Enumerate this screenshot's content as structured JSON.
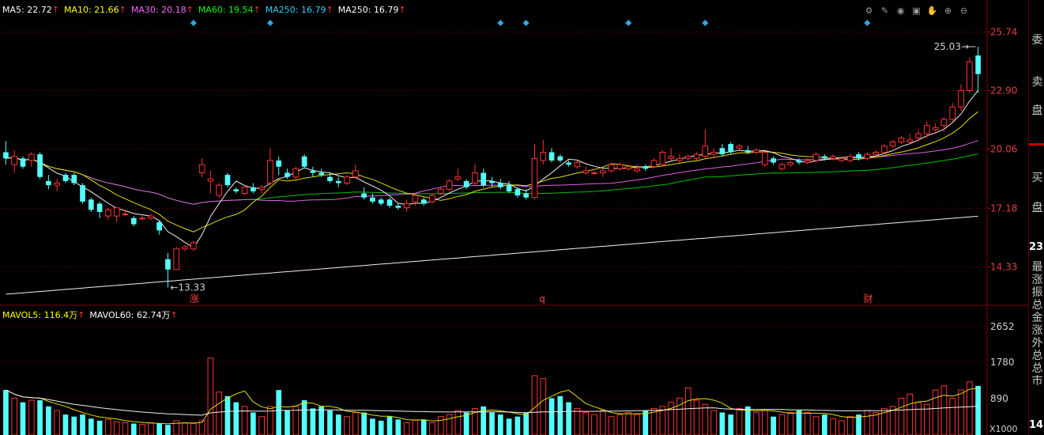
{
  "ma_legend": [
    {
      "label": "MA5: 22.72",
      "color": "#ffffff"
    },
    {
      "label": "MA10: 21.66",
      "color": "#ffff00"
    },
    {
      "label": "MA30: 20.18",
      "color": "#ff66ff"
    },
    {
      "label": "MA60: 19.54",
      "color": "#00ff00"
    },
    {
      "label": "MA250: 16.79",
      "color": "#33ccff"
    },
    {
      "label": "MA250: 16.79",
      "color": "#ffffff"
    }
  ],
  "arrow": "↑",
  "arrow_color": "#ff3333",
  "vol_legend": [
    {
      "label": "MAVOL5: 116.4万",
      "color": "#ffff00"
    },
    {
      "label": "MAVOL60: 62.74万",
      "color": "#ffffff"
    }
  ],
  "toolbar_icons": [
    "settings-icon",
    "pen-icon",
    "eye-icon",
    "save-icon",
    "hand-icon",
    "zoom-in-icon",
    "zoom-out-icon"
  ],
  "sidepanel": {
    "top_label": "委",
    "sell": [
      "卖",
      "盘"
    ],
    "buy": [
      "买",
      "盘"
    ],
    "number": "23",
    "stack": [
      "最",
      "涨",
      "振",
      "总",
      "金",
      "涨",
      "外",
      "总",
      "总",
      "市"
    ],
    "bottom_number": "14"
  },
  "chart_data": [
    {
      "type": "candlestick",
      "y_ticks": [
        25.74,
        22.9,
        20.06,
        17.18,
        14.33
      ],
      "ylim": [
        12.5,
        26.3
      ],
      "max_label": "25.03",
      "min_label": "13.33",
      "markers": [
        {
          "text": "涨",
          "index": 22
        },
        {
          "text": "q",
          "index": 63
        },
        {
          "text": "财",
          "index": 101
        }
      ],
      "diamond_indices": [
        22,
        31,
        58,
        61,
        73,
        82,
        101
      ],
      "ohlc": [
        [
          19.9,
          20.45,
          19.3,
          19.6
        ],
        [
          19.3,
          20.0,
          18.9,
          19.7
        ],
        [
          19.6,
          19.7,
          19.1,
          19.2
        ],
        [
          19.5,
          19.9,
          19.2,
          19.8
        ],
        [
          19.8,
          19.9,
          18.6,
          18.7
        ],
        [
          18.5,
          18.8,
          18.1,
          18.3
        ],
        [
          18.3,
          18.6,
          18.0,
          18.4
        ],
        [
          18.8,
          18.9,
          18.4,
          18.5
        ],
        [
          18.8,
          18.9,
          18.3,
          18.4
        ],
        [
          18.3,
          18.4,
          17.4,
          17.5
        ],
        [
          17.6,
          17.7,
          17.0,
          17.1
        ],
        [
          17.4,
          17.5,
          16.7,
          17.0
        ],
        [
          16.8,
          17.2,
          16.6,
          17.1
        ],
        [
          16.8,
          17.2,
          16.5,
          17.2
        ],
        [
          16.9,
          17.1,
          16.8,
          16.9
        ],
        [
          16.7,
          16.8,
          16.3,
          16.4
        ],
        [
          16.7,
          16.8,
          16.6,
          16.7
        ],
        [
          16.7,
          16.9,
          16.6,
          16.8
        ],
        [
          16.5,
          16.6,
          15.9,
          16.1
        ],
        [
          14.7,
          15.0,
          13.33,
          14.2
        ],
        [
          14.2,
          15.3,
          14.2,
          15.2
        ],
        [
          15.2,
          15.4,
          15.1,
          15.3
        ],
        [
          15.2,
          15.6,
          15.1,
          15.5
        ],
        [
          18.9,
          19.6,
          18.7,
          19.3
        ],
        [
          18.5,
          19.0,
          17.9,
          18.6
        ],
        [
          17.8,
          18.4,
          17.7,
          18.3
        ],
        [
          18.8,
          18.9,
          18.2,
          18.3
        ],
        [
          18.1,
          18.2,
          17.9,
          18.0
        ],
        [
          17.9,
          18.3,
          17.8,
          18.2
        ],
        [
          18.2,
          18.4,
          17.9,
          18.0
        ],
        [
          18.1,
          18.3,
          17.9,
          18.2
        ],
        [
          18.4,
          20.1,
          18.3,
          19.5
        ],
        [
          19.5,
          19.7,
          18.8,
          19.2
        ],
        [
          18.9,
          19.1,
          18.6,
          18.7
        ],
        [
          18.7,
          19.2,
          18.5,
          19.1
        ],
        [
          19.7,
          19.8,
          19.1,
          19.2
        ],
        [
          19.0,
          19.2,
          18.7,
          18.9
        ],
        [
          18.9,
          19.1,
          18.7,
          18.8
        ],
        [
          18.7,
          18.9,
          18.4,
          18.5
        ],
        [
          18.5,
          18.7,
          18.2,
          18.4
        ],
        [
          18.4,
          18.8,
          18.3,
          18.7
        ],
        [
          18.7,
          19.3,
          18.6,
          19.0
        ],
        [
          17.9,
          18.2,
          17.6,
          17.7
        ],
        [
          17.7,
          17.9,
          17.4,
          17.5
        ],
        [
          17.6,
          17.7,
          17.3,
          17.4
        ],
        [
          17.6,
          17.7,
          17.2,
          17.3
        ],
        [
          17.3,
          17.4,
          17.1,
          17.2
        ],
        [
          17.2,
          17.6,
          17.0,
          17.4
        ],
        [
          17.5,
          17.9,
          17.3,
          17.8
        ],
        [
          17.6,
          17.7,
          17.3,
          17.4
        ],
        [
          17.5,
          17.9,
          17.4,
          17.8
        ],
        [
          17.9,
          18.2,
          17.8,
          18.1
        ],
        [
          18.1,
          18.6,
          18.0,
          18.5
        ],
        [
          18.6,
          19.1,
          18.5,
          18.7
        ],
        [
          18.5,
          18.6,
          18.1,
          18.2
        ],
        [
          18.4,
          19.3,
          18.3,
          18.9
        ],
        [
          18.9,
          19.1,
          18.2,
          18.3
        ],
        [
          18.5,
          18.7,
          18.2,
          18.4
        ],
        [
          18.4,
          18.6,
          18.1,
          18.2
        ],
        [
          18.3,
          18.5,
          17.9,
          18.0
        ],
        [
          18.1,
          18.2,
          17.7,
          17.8
        ],
        [
          17.9,
          18.1,
          17.6,
          17.7
        ],
        [
          17.7,
          20.3,
          17.6,
          19.6
        ],
        [
          19.5,
          20.5,
          19.3,
          19.9
        ],
        [
          19.9,
          20.1,
          19.4,
          19.5
        ],
        [
          19.7,
          19.8,
          19.4,
          19.5
        ],
        [
          19.4,
          19.5,
          19.2,
          19.3
        ],
        [
          19.2,
          19.5,
          19.1,
          19.4
        ],
        [
          18.9,
          19.2,
          18.8,
          19.0
        ],
        [
          18.9,
          19.0,
          18.8,
          18.9
        ],
        [
          18.9,
          19.1,
          18.7,
          19.0
        ],
        [
          19.0,
          19.4,
          18.9,
          19.3
        ],
        [
          19.1,
          19.4,
          19.0,
          19.3
        ],
        [
          19.1,
          19.3,
          19.0,
          19.2
        ],
        [
          19.0,
          19.3,
          18.9,
          19.1
        ],
        [
          19.2,
          19.3,
          19.0,
          19.1
        ],
        [
          19.2,
          19.6,
          19.1,
          19.5
        ],
        [
          19.3,
          20.0,
          19.2,
          19.9
        ],
        [
          19.6,
          20.1,
          19.5,
          19.7
        ],
        [
          19.5,
          19.8,
          19.4,
          19.6
        ],
        [
          19.6,
          19.8,
          19.5,
          19.7
        ],
        [
          19.6,
          19.9,
          19.5,
          19.8
        ],
        [
          19.7,
          21.0,
          19.6,
          20.2
        ],
        [
          19.8,
          20.1,
          19.6,
          19.9
        ],
        [
          20.1,
          20.3,
          19.7,
          19.8
        ],
        [
          20.3,
          20.4,
          19.8,
          19.9
        ],
        [
          20.1,
          20.3,
          20.0,
          20.2
        ],
        [
          20.0,
          20.2,
          19.8,
          19.9
        ],
        [
          19.9,
          20.1,
          19.8,
          20.0
        ],
        [
          19.3,
          19.9,
          19.2,
          19.9
        ],
        [
          19.6,
          19.7,
          19.3,
          19.4
        ],
        [
          19.1,
          19.4,
          19.0,
          19.3
        ],
        [
          19.3,
          19.5,
          19.2,
          19.4
        ],
        [
          19.5,
          19.6,
          19.3,
          19.4
        ],
        [
          19.4,
          19.6,
          19.3,
          19.5
        ],
        [
          19.5,
          19.9,
          19.4,
          19.8
        ],
        [
          19.7,
          19.8,
          19.5,
          19.6
        ],
        [
          19.6,
          19.8,
          19.5,
          19.7
        ],
        [
          19.5,
          19.7,
          19.4,
          19.6
        ],
        [
          19.5,
          19.8,
          19.4,
          19.7
        ],
        [
          19.8,
          19.9,
          19.5,
          19.6
        ],
        [
          19.6,
          19.9,
          19.5,
          19.8
        ],
        [
          19.8,
          20.0,
          19.6,
          19.9
        ],
        [
          19.9,
          20.3,
          19.8,
          20.2
        ],
        [
          20.2,
          20.5,
          20.1,
          20.4
        ],
        [
          20.4,
          20.7,
          20.3,
          20.6
        ],
        [
          20.4,
          20.8,
          20.3,
          20.5
        ],
        [
          20.6,
          21.0,
          20.4,
          20.8
        ],
        [
          20.8,
          21.4,
          20.6,
          21.2
        ],
        [
          21.0,
          21.3,
          20.8,
          21.1
        ],
        [
          21.2,
          21.6,
          20.9,
          21.5
        ],
        [
          21.5,
          22.3,
          21.3,
          22.1
        ],
        [
          22.1,
          23.2,
          21.9,
          22.9
        ],
        [
          22.9,
          24.5,
          22.8,
          24.3
        ],
        [
          24.6,
          25.03,
          22.8,
          23.7
        ]
      ],
      "volume": {
        "y_ticks": [
          2652,
          1780,
          890
        ],
        "unit_label": "X1000",
        "ylim": [
          0,
          2900
        ],
        "values": [
          1100,
          900,
          800,
          850,
          850,
          700,
          600,
          500,
          450,
          500,
          400,
          350,
          380,
          320,
          300,
          280,
          260,
          300,
          280,
          250,
          350,
          300,
          280,
          350,
          1880,
          1050,
          950,
          800,
          700,
          550,
          450,
          700,
          1100,
          600,
          700,
          850,
          650,
          700,
          600,
          500,
          450,
          550,
          550,
          400,
          350,
          450,
          380,
          300,
          360,
          380,
          300,
          450,
          500,
          600,
          550,
          650,
          700,
          550,
          500,
          400,
          450,
          550,
          1450,
          1380,
          900,
          950,
          800,
          650,
          550,
          500,
          600,
          450,
          500,
          550,
          500,
          600,
          650,
          700,
          800,
          900,
          1150,
          850,
          750,
          600,
          550,
          500,
          650,
          700,
          550,
          600,
          450,
          500,
          550,
          600,
          550,
          450,
          500,
          400,
          350,
          450,
          500,
          600,
          550,
          650,
          700,
          900,
          1000,
          800,
          750,
          1100,
          1200,
          900,
          1100,
          1300,
          1200
        ]
      }
    }
  ]
}
